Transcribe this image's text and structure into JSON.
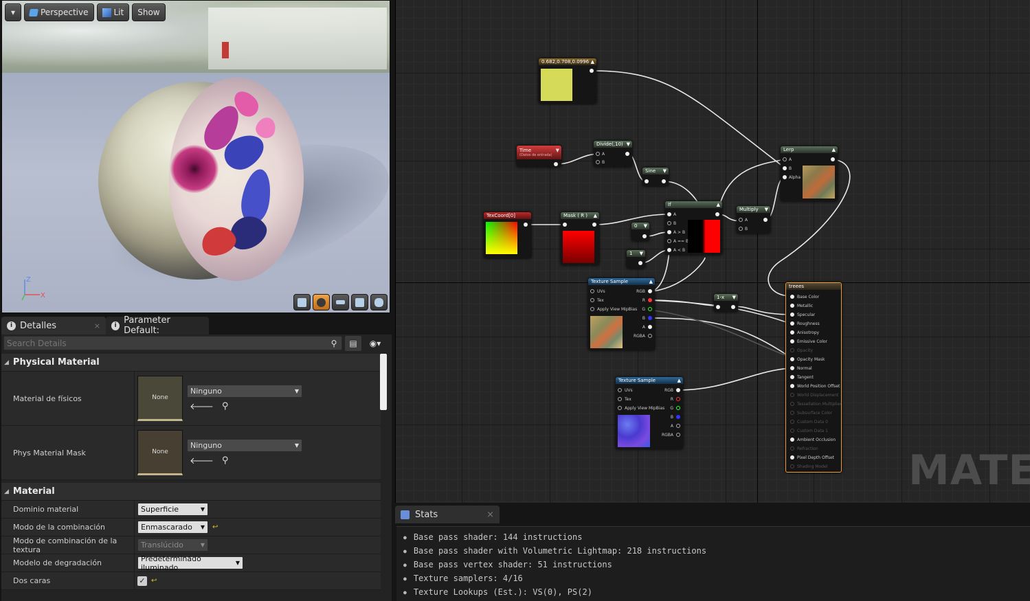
{
  "viewport": {
    "menu_glyph": "▾",
    "buttons": {
      "perspective": "Perspective",
      "lit": "Lit",
      "show": "Show"
    },
    "axis": {
      "z": "Z",
      "x": "X"
    }
  },
  "details_panel": {
    "tabs": [
      {
        "label": "Detalles",
        "close": "×"
      },
      {
        "label": "Parameter Default:"
      }
    ],
    "search_placeholder": "Search Details",
    "sections": {
      "physical_material": {
        "title": "Physical Material",
        "rows": [
          {
            "label": "Material de físicos",
            "thumb_text": "None",
            "combo": "Ninguno"
          },
          {
            "label": "Phys Material Mask",
            "thumb_text": "None",
            "combo": "Ninguno"
          }
        ]
      },
      "material": {
        "title": "Material",
        "rows": [
          {
            "label": "Dominio material",
            "value": "Superficie"
          },
          {
            "label": "Modo de la combinación",
            "value": "Enmascarado"
          },
          {
            "label": "Modo de combinación de la textura",
            "value": "Translúcido"
          },
          {
            "label": "Modelo de degradación",
            "value": "Predeterminado iluminado"
          },
          {
            "label": "Dos caras",
            "value": "✓"
          }
        ]
      }
    }
  },
  "graph": {
    "watermark": "MATER",
    "nodes": {
      "constant3": {
        "title": "0.682,0.708,0.0996",
        "color": "#d6da59"
      },
      "time": {
        "title": "Time",
        "subtitle": "(Datos de entrada)"
      },
      "divide": {
        "title": "Divide(,10)",
        "pins": [
          "A",
          "B"
        ]
      },
      "sine": {
        "title": "Sine"
      },
      "texcoord": {
        "title": "TexCoord[0]"
      },
      "mask": {
        "title": "Mask ( R )"
      },
      "if": {
        "title": "If",
        "pins": [
          "A",
          "B",
          "A > B",
          "A == B",
          "A < B"
        ]
      },
      "const0": {
        "title": "0"
      },
      "const1": {
        "title": "1"
      },
      "multiply": {
        "title": "Multiply",
        "pins": [
          "A",
          "B"
        ]
      },
      "lerp": {
        "title": "Lerp",
        "pins": [
          "A",
          "B",
          "Alpha"
        ]
      },
      "oneminus": {
        "title": "1-x"
      },
      "texsample1": {
        "title": "Texture Sample",
        "inputs": [
          "UVs",
          "Tex",
          "Apply View MipBias"
        ],
        "outputs": [
          "RGB",
          "R",
          "G",
          "B",
          "A",
          "RGBA"
        ]
      },
      "texsample2": {
        "title": "Texture Sample",
        "inputs": [
          "UVs",
          "Tex",
          "Apply View MipBias"
        ],
        "outputs": [
          "RGB",
          "R",
          "G",
          "B",
          "A",
          "RGBA"
        ]
      },
      "result": {
        "title": "treees",
        "pins": [
          "Base Color",
          "Metallic",
          "Specular",
          "Roughness",
          "Anisotropy",
          "Emissive Color",
          "Opacity",
          "Opacity Mask",
          "Normal",
          "Tangent",
          "World Position Offset",
          "World Displacement",
          "Tessellation Multiplier",
          "Subsurface Color",
          "Custom Data 0",
          "Custom Data 1",
          "Ambient Occlusion",
          "Refraction",
          "Pixel Depth Offset",
          "Shading Model"
        ],
        "dim_pins": [
          6,
          11,
          12,
          13,
          14,
          15,
          17,
          19
        ]
      }
    }
  },
  "stats": {
    "tab": "Stats",
    "close": "×",
    "lines": [
      "Base pass shader: 144 instructions",
      "Base pass shader with Volumetric Lightmap: 218 instructions",
      "Base pass vertex shader: 51 instructions",
      "Texture samplers: 4/16",
      "Texture Lookups (Est.): VS(0), PS(2)"
    ]
  }
}
